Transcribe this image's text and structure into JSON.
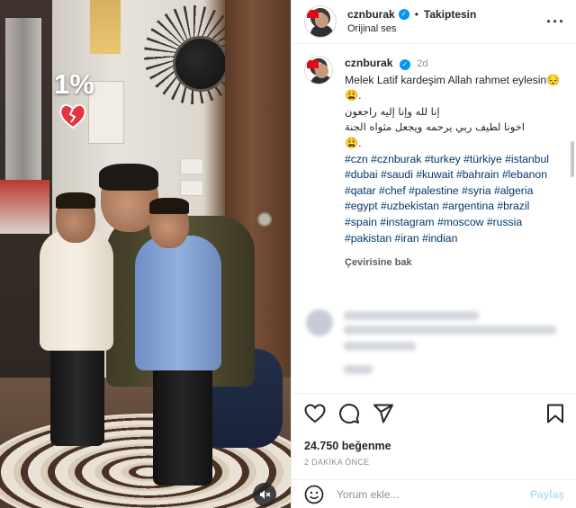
{
  "photo": {
    "percent_text": "1%",
    "heart_icon": "cracked-heart",
    "mute_icon": "speaker-muted"
  },
  "header": {
    "username": "cznburak",
    "follow_label": "Takiptesin",
    "audio_label": "Orijinal ses"
  },
  "caption": {
    "username": "cznburak",
    "time": "2d",
    "line1": "Melek Latif kardeşim Allah rahmet eylesin😔😩.",
    "arabic1": "إنا لله وإنا إليه راجعون",
    "arabic2": "اخونا لطيف ربي يرحمه ويجعل مثواه الجنة",
    "emoji_line": "😩.",
    "hashtags": "#czn #cznburak #turkey #türkiye #istanbul #dubai #saudi #kuwait #bahrain #lebanon #qatar #chef #palestine #syria #algeria #egypt #uzbekistan #argentina #brazil #spain #instagram #moscow #russia #pakistan #iran #indian",
    "translate_label": "Çevirisine bak"
  },
  "actions": {
    "likes": "24.750 beğenme",
    "ago": "2 DAKİKA ÖNCE"
  },
  "comment_box": {
    "placeholder": "Yorum ekle...",
    "post_label": "Paylaş"
  },
  "colors": {
    "verified": "#0095f6",
    "hashtag": "#00376b",
    "post_disabled": "#b2dffc"
  }
}
